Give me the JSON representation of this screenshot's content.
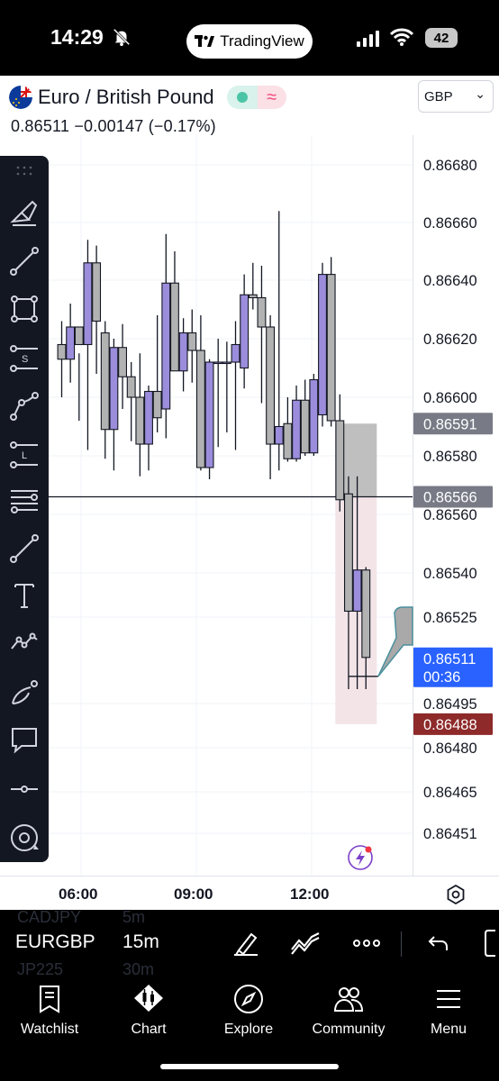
{
  "status_bar": {
    "time": "14:29",
    "app_pill_label": "TradingView",
    "battery": "42"
  },
  "header": {
    "symbol": "Euro / British Pound",
    "price_line": "0.86511 −0.00147 (−0.17%)",
    "currency": "GBP",
    "currency_chevron": "⌄"
  },
  "price_axis": {
    "ticks": [
      "0.86680",
      "0.86660",
      "0.86640",
      "0.86620",
      "0.86600",
      "0.86580",
      "0.86560",
      "0.86540",
      "0.86525",
      "0.86495",
      "0.86480",
      "0.86465",
      "0.86451"
    ],
    "tags": [
      {
        "value": "0.86591",
        "color": "#787b86"
      },
      {
        "value": "0.86566",
        "color": "#787b86"
      },
      {
        "value": "0.86511",
        "sub": "00:36",
        "color": "#2962ff"
      },
      {
        "value": "0.86488",
        "color": "#8e2a2a"
      }
    ]
  },
  "chart_data": {
    "type": "candlestick",
    "symbol": "EURGBP",
    "timeframe": "15m",
    "x_ticks": [
      "06:00",
      "09:00",
      "12:00"
    ],
    "y_ticks": [
      0.8668,
      0.8666,
      0.8664,
      0.8662,
      0.866,
      0.8658,
      0.8656,
      0.8654,
      0.86525,
      0.86495,
      0.8648,
      0.86465,
      0.86451
    ],
    "horizontal_line": 0.86566,
    "position_zone": {
      "entry": 0.86566,
      "target_top": 0.86591,
      "stop_bottom": 0.86488
    },
    "colors": {
      "up": "#9b8ddb",
      "down": "#b2b2b2",
      "wick": "#131722"
    },
    "candles": [
      {
        "o": 0.86618,
        "h": 0.86626,
        "l": 0.866,
        "c": 0.86613
      },
      {
        "o": 0.86613,
        "h": 0.86632,
        "l": 0.86605,
        "c": 0.86624
      },
      {
        "o": 0.86624,
        "h": 0.86615,
        "l": 0.86592,
        "c": 0.86618
      },
      {
        "o": 0.86618,
        "h": 0.86654,
        "l": 0.86582,
        "c": 0.86646
      },
      {
        "o": 0.86646,
        "h": 0.86652,
        "l": 0.86608,
        "c": 0.86626
      },
      {
        "o": 0.86622,
        "h": 0.86626,
        "l": 0.86579,
        "c": 0.86589
      },
      {
        "o": 0.86589,
        "h": 0.8662,
        "l": 0.86575,
        "c": 0.86617
      },
      {
        "o": 0.86617,
        "h": 0.86625,
        "l": 0.86596,
        "c": 0.86607
      },
      {
        "o": 0.86607,
        "h": 0.86612,
        "l": 0.86585,
        "c": 0.866
      },
      {
        "o": 0.866,
        "h": 0.86615,
        "l": 0.86573,
        "c": 0.86584
      },
      {
        "o": 0.86584,
        "h": 0.86604,
        "l": 0.86575,
        "c": 0.86602
      },
      {
        "o": 0.86602,
        "h": 0.86628,
        "l": 0.86588,
        "c": 0.86593
      },
      {
        "o": 0.86596,
        "h": 0.86656,
        "l": 0.86586,
        "c": 0.86639
      },
      {
        "o": 0.86639,
        "h": 0.8665,
        "l": 0.86612,
        "c": 0.86609
      },
      {
        "o": 0.86609,
        "h": 0.86627,
        "l": 0.86602,
        "c": 0.86622
      },
      {
        "o": 0.86622,
        "h": 0.8663,
        "l": 0.86605,
        "c": 0.86616
      },
      {
        "o": 0.86616,
        "h": 0.86628,
        "l": 0.86575,
        "c": 0.86576
      },
      {
        "o": 0.86576,
        "h": 0.86613,
        "l": 0.86572,
        "c": 0.86612
      },
      {
        "o": 0.86612,
        "h": 0.8662,
        "l": 0.86583,
        "c": 0.86612
      },
      {
        "o": 0.86612,
        "h": 0.86619,
        "l": 0.86588,
        "c": 0.86612
      },
      {
        "o": 0.86612,
        "h": 0.86626,
        "l": 0.86582,
        "c": 0.86618
      },
      {
        "o": 0.8661,
        "h": 0.86642,
        "l": 0.86603,
        "c": 0.86635
      },
      {
        "o": 0.86635,
        "h": 0.86646,
        "l": 0.8663,
        "c": 0.86634
      },
      {
        "o": 0.86634,
        "h": 0.86645,
        "l": 0.86598,
        "c": 0.86624
      },
      {
        "o": 0.86624,
        "h": 0.86628,
        "l": 0.86572,
        "c": 0.86584
      },
      {
        "o": 0.86584,
        "h": 0.86664,
        "l": 0.86575,
        "c": 0.8659
      },
      {
        "o": 0.86591,
        "h": 0.866,
        "l": 0.86578,
        "c": 0.86579
      },
      {
        "o": 0.86579,
        "h": 0.86604,
        "l": 0.86578,
        "c": 0.86599
      },
      {
        "o": 0.86599,
        "h": 0.86606,
        "l": 0.8658,
        "c": 0.86581
      },
      {
        "o": 0.86581,
        "h": 0.86608,
        "l": 0.8658,
        "c": 0.86606
      },
      {
        "o": 0.86594,
        "h": 0.86646,
        "l": 0.8659,
        "c": 0.86642
      },
      {
        "o": 0.86642,
        "h": 0.86648,
        "l": 0.8659,
        "c": 0.86592
      },
      {
        "o": 0.86592,
        "h": 0.86601,
        "l": 0.86561,
        "c": 0.86565
      },
      {
        "o": 0.86567,
        "h": 0.86573,
        "l": 0.865,
        "c": 0.86527
      },
      {
        "o": 0.86527,
        "h": 0.86573,
        "l": 0.865,
        "c": 0.86541
      },
      {
        "o": 0.86541,
        "h": 0.86542,
        "l": 0.865,
        "c": 0.86511
      }
    ]
  },
  "toolbar": {
    "tools": [
      "brush-icon",
      "trend-line-icon",
      "rectangle-icon",
      "horizontal-ray-s-icon",
      "path-icon",
      "horizontal-ray-l-icon",
      "parallel-lines-icon",
      "line-icon",
      "text-icon",
      "pattern-icon",
      "curve-icon",
      "callout-icon",
      "horizontal-line-icon",
      "target-icon"
    ]
  },
  "time_axis": {
    "labels": [
      "06:00",
      "09:00",
      "12:00"
    ]
  },
  "symbol_bar": {
    "ghost_above": {
      "symbol": "CADJPY",
      "timeframe": "5m"
    },
    "symbol": "EURGBP",
    "timeframe": "15m",
    "ghost_below": {
      "symbol": "JP225",
      "timeframe": "30m"
    }
  },
  "bottom_nav": {
    "items": [
      "Watchlist",
      "Chart",
      "Explore",
      "Community",
      "Menu"
    ]
  }
}
